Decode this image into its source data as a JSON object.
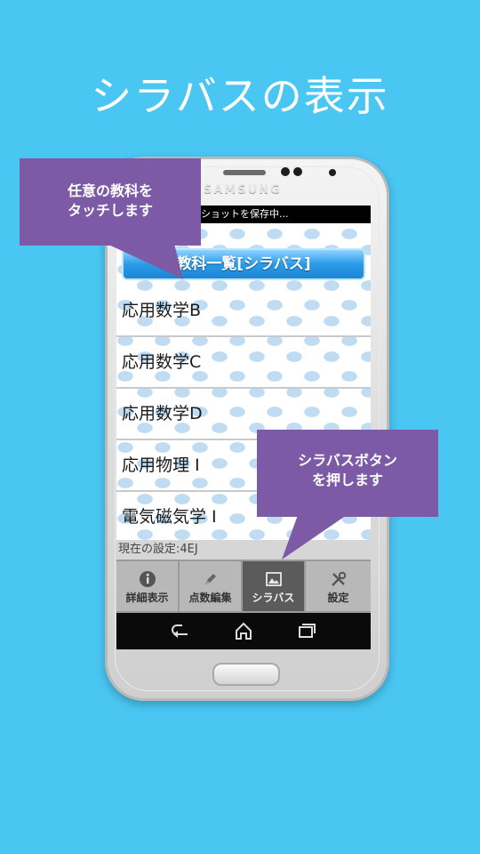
{
  "headline": "シラバスの表示",
  "phone": {
    "brand": "SAMSUNG",
    "status_text": "ショットを保存中..."
  },
  "app": {
    "title": "教科一覧[シラバス]",
    "subjects": [
      "応用数学B",
      "応用数学C",
      "応用数学D",
      "応用物理 I",
      "電気磁気学 I"
    ],
    "current_setting": "現在の設定:4EJ",
    "tabs": [
      {
        "label": "詳細表示",
        "icon": "info-icon",
        "active": false
      },
      {
        "label": "点数編集",
        "icon": "pencil-icon",
        "active": false
      },
      {
        "label": "シラバス",
        "icon": "picture-icon",
        "active": true
      },
      {
        "label": "設定",
        "icon": "tools-icon",
        "active": false
      }
    ],
    "nav": [
      "back-icon",
      "home-icon",
      "recent-apps-icon"
    ]
  },
  "callouts": {
    "left": [
      "任意の教科を",
      "タッチします"
    ],
    "right": [
      "シラバスボタン",
      "を押します"
    ]
  },
  "colors": {
    "background": "#4ac6f2",
    "callout": "#7c5aa6",
    "title_bar": "#2a9be8",
    "active_tab": "#5b5b5b"
  }
}
